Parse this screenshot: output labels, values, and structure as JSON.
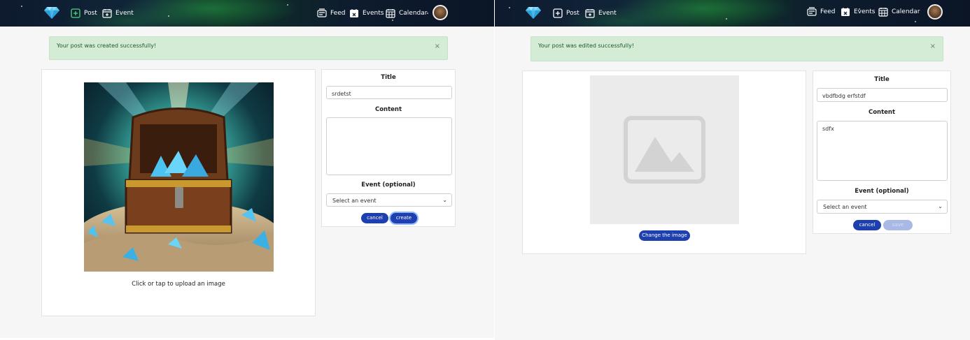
{
  "left": {
    "nav": {
      "post": "Post",
      "event": "Event",
      "feed": "Feed",
      "events": "Events",
      "calendar": "Calendar"
    },
    "alert": {
      "message": "Your post was created successfully!",
      "close": "×"
    },
    "upload_caption": "Click or tap to upload an image",
    "form": {
      "title_label": "Title",
      "title_value": "srdetst",
      "content_label": "Content",
      "content_value": "",
      "event_label": "Event (optional)",
      "event_selected": "Select an event",
      "cancel_label": "cancel",
      "submit_label": "create"
    }
  },
  "right": {
    "nav": {
      "post": "Post",
      "event": "Event",
      "feed": "Feed",
      "events": "Events",
      "calendar": "Calendar"
    },
    "alert": {
      "message": "Your post was edited successfully!",
      "close": "×"
    },
    "change_image_label": "Change the image",
    "form": {
      "title_label": "Title",
      "title_value": "vbdfbdg erfstdf",
      "content_label": "Content",
      "content_value": "sdfx",
      "event_label": "Event (optional)",
      "event_selected": "Select an event",
      "cancel_label": "cancel",
      "submit_label": "save"
    }
  },
  "colors": {
    "primary": "#1e3fae",
    "success_bg": "#d4ebd6",
    "success_text": "#1e5a2a",
    "page_bg": "#f6f6f6"
  }
}
